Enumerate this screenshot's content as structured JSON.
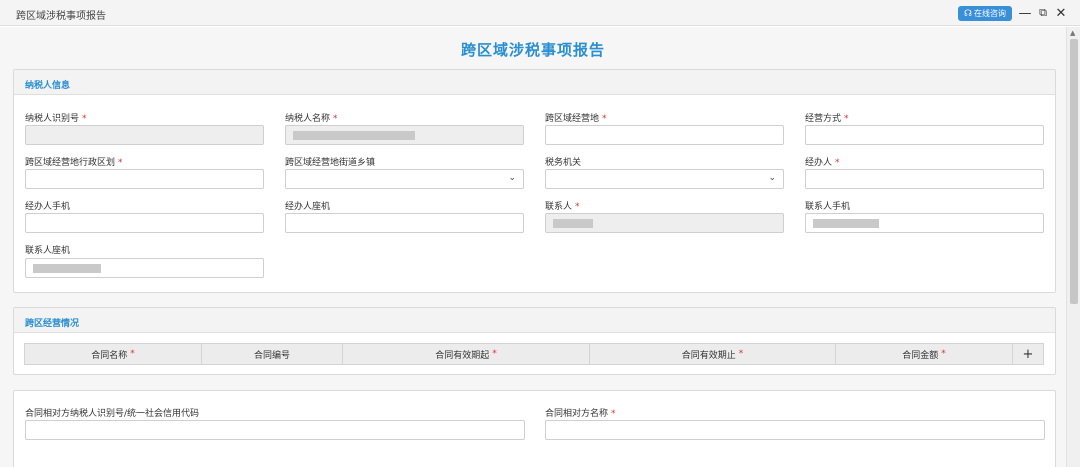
{
  "window": {
    "title": "跨区域涉税事项报告",
    "help_label": "在线咨询"
  },
  "page": {
    "title": "跨区域涉税事项报告"
  },
  "sections": {
    "taxpayer": {
      "title": "纳税人信息",
      "fields": {
        "tax_id": {
          "label": "纳税人识别号",
          "required": "*",
          "value": ""
        },
        "taxpayer_name": {
          "label": "纳税人名称",
          "required": "*",
          "value": ""
        },
        "cross_region_location": {
          "label": "跨区域经营地",
          "required": "*",
          "value": ""
        },
        "business_mode": {
          "label": "经营方式",
          "required": "*",
          "value": ""
        },
        "admin_division": {
          "label": "跨区域经营地行政区划",
          "required": "*",
          "value": ""
        },
        "street_town": {
          "label": "跨区域经营地街道乡镇",
          "value": ""
        },
        "tax_authority": {
          "label": "税务机关",
          "value": ""
        },
        "handler": {
          "label": "经办人",
          "required": "*",
          "value": ""
        },
        "handler_mobile": {
          "label": "经办人手机",
          "value": ""
        },
        "handler_landline": {
          "label": "经办人座机",
          "value": ""
        },
        "contact": {
          "label": "联系人",
          "required": "*",
          "value": ""
        },
        "contact_mobile": {
          "label": "联系人手机",
          "value": ""
        },
        "contact_landline": {
          "label": "联系人座机",
          "value": ""
        }
      }
    },
    "operations": {
      "title": "跨区经营情况",
      "columns": [
        {
          "label": "合同名称",
          "required": "*"
        },
        {
          "label": "合同编号",
          "required": ""
        },
        {
          "label": "合同有效期起",
          "required": "*"
        },
        {
          "label": "合同有效期止",
          "required": "*"
        },
        {
          "label": "合同金额",
          "required": "*"
        }
      ],
      "add_label": "+"
    },
    "counterparty": {
      "fields": {
        "counterparty_id": {
          "label": "合同相对方纳税人识别号/统一社会信用代码",
          "value": ""
        },
        "counterparty_name": {
          "label": "合同相对方名称",
          "required": "*",
          "value": ""
        }
      }
    }
  },
  "icons": {
    "help": "headset-icon",
    "minimize": "minimize-icon",
    "maximize": "maximize-icon",
    "close": "close-icon"
  },
  "colors": {
    "accent": "#2a8fd1",
    "required": "#e03030",
    "help_button": "#3a8fd9"
  }
}
